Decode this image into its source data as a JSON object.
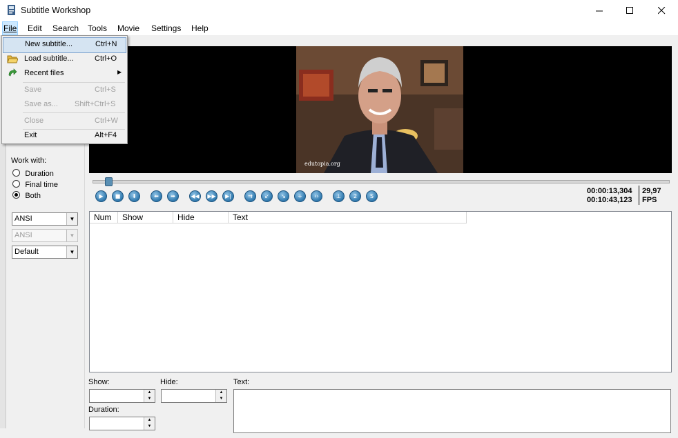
{
  "window": {
    "title": "Subtitle Workshop"
  },
  "menubar": {
    "items": [
      "File",
      "Edit",
      "Search",
      "Tools",
      "Movie",
      "Settings",
      "Help"
    ]
  },
  "file_menu": {
    "items": [
      {
        "label": "New subtitle...",
        "shortcut": "Ctrl+N",
        "enabled": true
      },
      {
        "label": "Load subtitle...",
        "shortcut": "Ctrl+O",
        "enabled": true
      },
      {
        "label": "Recent files",
        "shortcut": "",
        "enabled": true
      },
      {
        "label": "Save",
        "shortcut": "Ctrl+S",
        "enabled": false
      },
      {
        "label": "Save as...",
        "shortcut": "Shift+Ctrl+S",
        "enabled": false
      },
      {
        "label": "Close",
        "shortcut": "Ctrl+W",
        "enabled": false
      },
      {
        "label": "Exit",
        "shortcut": "Alt+F4",
        "enabled": true
      }
    ]
  },
  "left_panel": {
    "work_with_label": "Work with:",
    "options": [
      "Duration",
      "Final time",
      "Both"
    ],
    "selected": "Both",
    "charset1": "ANSI",
    "charset2": "ANSI",
    "format": "Default"
  },
  "video": {
    "watermark": "edutopia.org",
    "seek_position": 0.027
  },
  "time_display": {
    "current": "00:00:13,304",
    "total": "00:10:43,123",
    "fps_value": "29,97",
    "fps_label": "FPS"
  },
  "list": {
    "columns": [
      "Num",
      "Show",
      "Hide",
      "Text"
    ]
  },
  "editor": {
    "show_label": "Show:",
    "hide_label": "Hide:",
    "text_label": "Text:",
    "duration_label": "Duration:"
  },
  "icons": {
    "controls": [
      "play-icon",
      "stop-icon",
      "download-icon",
      "back-icon",
      "forward-icon",
      "rewind-icon",
      "fast-forward-icon",
      "skip-end-icon",
      "sync-icon",
      "set-start-icon",
      "set-end-icon",
      "add-icon",
      "sub-icon",
      "start-subtitle-icon",
      "end-subtitle-icon",
      "s-icon"
    ]
  }
}
